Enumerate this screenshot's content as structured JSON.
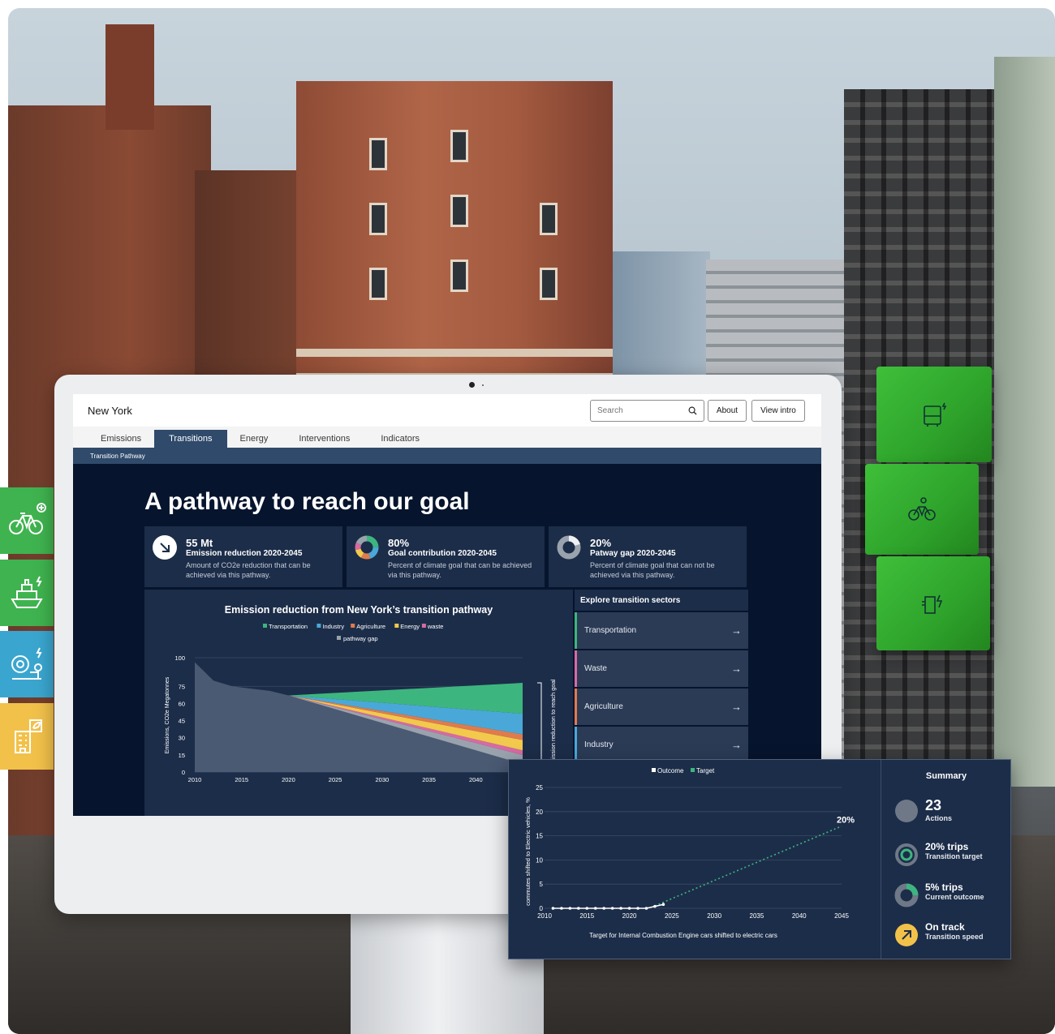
{
  "app": {
    "city": "New York",
    "search_placeholder": "Search",
    "about_label": "About",
    "view_intro_label": "View intro"
  },
  "tabs": [
    {
      "label": "Emissions",
      "active": false
    },
    {
      "label": "Transitions",
      "active": true
    },
    {
      "label": "Energy",
      "active": false
    },
    {
      "label": "Interventions",
      "active": false
    },
    {
      "label": "Indicators",
      "active": false
    }
  ],
  "subnav": {
    "label": "Transition Pathway"
  },
  "dashboard": {
    "heading": "A pathway to reach our goal",
    "kpis": [
      {
        "value": "55 Mt",
        "label": "Emission reduction 2020-2045",
        "description": "Amount of CO2e reduction that can be achieved via this pathway.",
        "icon": "arrow-down-right-icon"
      },
      {
        "value": "80%",
        "label": "Goal contribution 2020-2045",
        "description": "Percent of climate goal that can be achieved via this pathway.",
        "icon": "donut-icon"
      },
      {
        "value": "20%",
        "label": "Patway gap 2020-2045",
        "description": "Percent of climate goal that can not be achieved via this pathway.",
        "icon": "donut-gap-icon"
      }
    ],
    "sectors": {
      "heading": "Explore transition sectors",
      "items": [
        {
          "label": "Transportation",
          "color": "#3db57f"
        },
        {
          "label": "Waste",
          "color": "#d86aa3"
        },
        {
          "label": "Agriculture",
          "color": "#e07b4d"
        },
        {
          "label": "Industry",
          "color": "#4aa8d8"
        }
      ]
    }
  },
  "summary": {
    "title": "Summary",
    "items": [
      {
        "value": "23",
        "label": "Actions",
        "icon": "grey-dot-icon"
      },
      {
        "value": "20% trips",
        "label": "Transition target",
        "icon": "target-ring-icon"
      },
      {
        "value": "5% trips",
        "label": "Current outcome",
        "icon": "progress-donut-icon"
      },
      {
        "value": "On track",
        "label": "Transition speed",
        "icon": "arrow-up-right-icon"
      }
    ]
  },
  "chart_data": [
    {
      "type": "area",
      "title": "Emission reduction from New York’s transition pathway",
      "xlabel": "",
      "ylabel": "Emissions, CO2e Megatonnes",
      "right_label": "Emission reduction to reach goal",
      "x_ticks": [
        2010,
        2015,
        2020,
        2025,
        2030,
        2035,
        2040
      ],
      "y_ticks": [
        0,
        15,
        30,
        45,
        60,
        75,
        100
      ],
      "ylim": [
        0,
        100
      ],
      "xlim": [
        2010,
        2045
      ],
      "legend": [
        {
          "name": "Transportation",
          "color": "#3db57f"
        },
        {
          "name": "Industry",
          "color": "#4aa8d8"
        },
        {
          "name": "Agriculture",
          "color": "#e07b4d"
        },
        {
          "name": "Energy",
          "color": "#f2c94c"
        },
        {
          "name": "waste",
          "color": "#d86aa3"
        },
        {
          "name": "pathway gap",
          "color": "#9aa3ad"
        }
      ],
      "baseline": {
        "x": [
          2010,
          2012,
          2014,
          2016,
          2018,
          2020
        ],
        "y": [
          96,
          80,
          75,
          73,
          71,
          67
        ]
      },
      "pathway_end_2045": {
        "base": 7,
        "pathway gap": 15,
        "waste": 19,
        "Energy": 28,
        "Agriculture": 33,
        "Industry": 51,
        "Transportation": 78
      }
    },
    {
      "type": "line",
      "title": "",
      "xlabel": "Target for Internal Combustion Engine cars shifted to electric cars",
      "ylabel": "commutes shifted to Electric vehicles, %",
      "x_ticks": [
        2010,
        2015,
        2020,
        2025,
        2030,
        2035,
        2040,
        2045
      ],
      "y_ticks": [
        0,
        5,
        10,
        15,
        20,
        25
      ],
      "xlim": [
        2010,
        2045
      ],
      "ylim": [
        0,
        25
      ],
      "series": [
        {
          "name": "Outcome",
          "color": "#ffffff",
          "x": [
            2011,
            2012,
            2013,
            2014,
            2015,
            2016,
            2017,
            2018,
            2019,
            2020,
            2021,
            2022,
            2023,
            2024
          ],
          "y": [
            0,
            0,
            0,
            0,
            0,
            0,
            0,
            0,
            0,
            0,
            0,
            0,
            0.4,
            0.8
          ]
        },
        {
          "name": "Target",
          "color": "#3db57f",
          "x": [
            2023,
            2045
          ],
          "y": [
            0.5,
            17
          ]
        }
      ],
      "annotation": "20%"
    }
  ]
}
